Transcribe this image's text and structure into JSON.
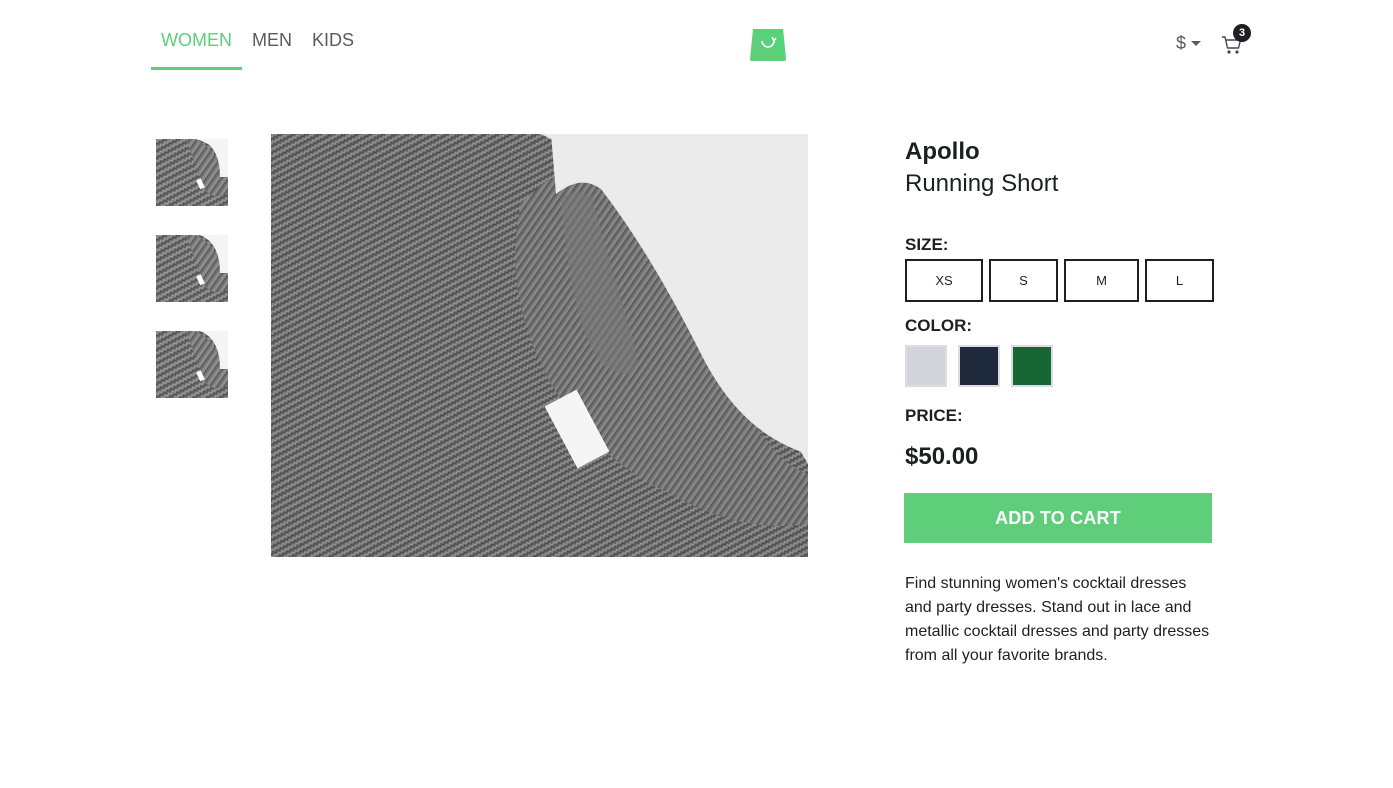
{
  "nav": {
    "items": [
      {
        "label": "WOMEN",
        "active": true
      },
      {
        "label": "MEN",
        "active": false
      },
      {
        "label": "KIDS",
        "active": false
      }
    ]
  },
  "logo": {
    "icon": "shopping-bag-logo-icon",
    "color": "#5ece7b"
  },
  "header_actions": {
    "currency_symbol": "$",
    "cart_icon": "cart-icon",
    "cart_count": "3"
  },
  "gallery": {
    "thumbnails": [
      "sweater-thumb-1",
      "sweater-thumb-2",
      "sweater-thumb-3"
    ],
    "main_image": "grey-knit-sweater-collar"
  },
  "product": {
    "brand": "Apollo",
    "name": "Running Short",
    "size_label": "SIZE:",
    "sizes": [
      "XS",
      "S",
      "M",
      "L"
    ],
    "color_label": "COLOR:",
    "colors": [
      "#d3d5db",
      "#1e293b",
      "#166534"
    ],
    "price_label": "PRICE:",
    "price": "$50.00",
    "add_to_cart": "ADD TO CART",
    "description": "Find stunning women's cocktail dresses and party dresses. Stand out in lace and metallic cocktail dresses and party dresses from all your favorite brands."
  },
  "colors": {
    "accent": "#5ece7b",
    "text": "#1d1f22",
    "muted": "#5b5b5b"
  }
}
